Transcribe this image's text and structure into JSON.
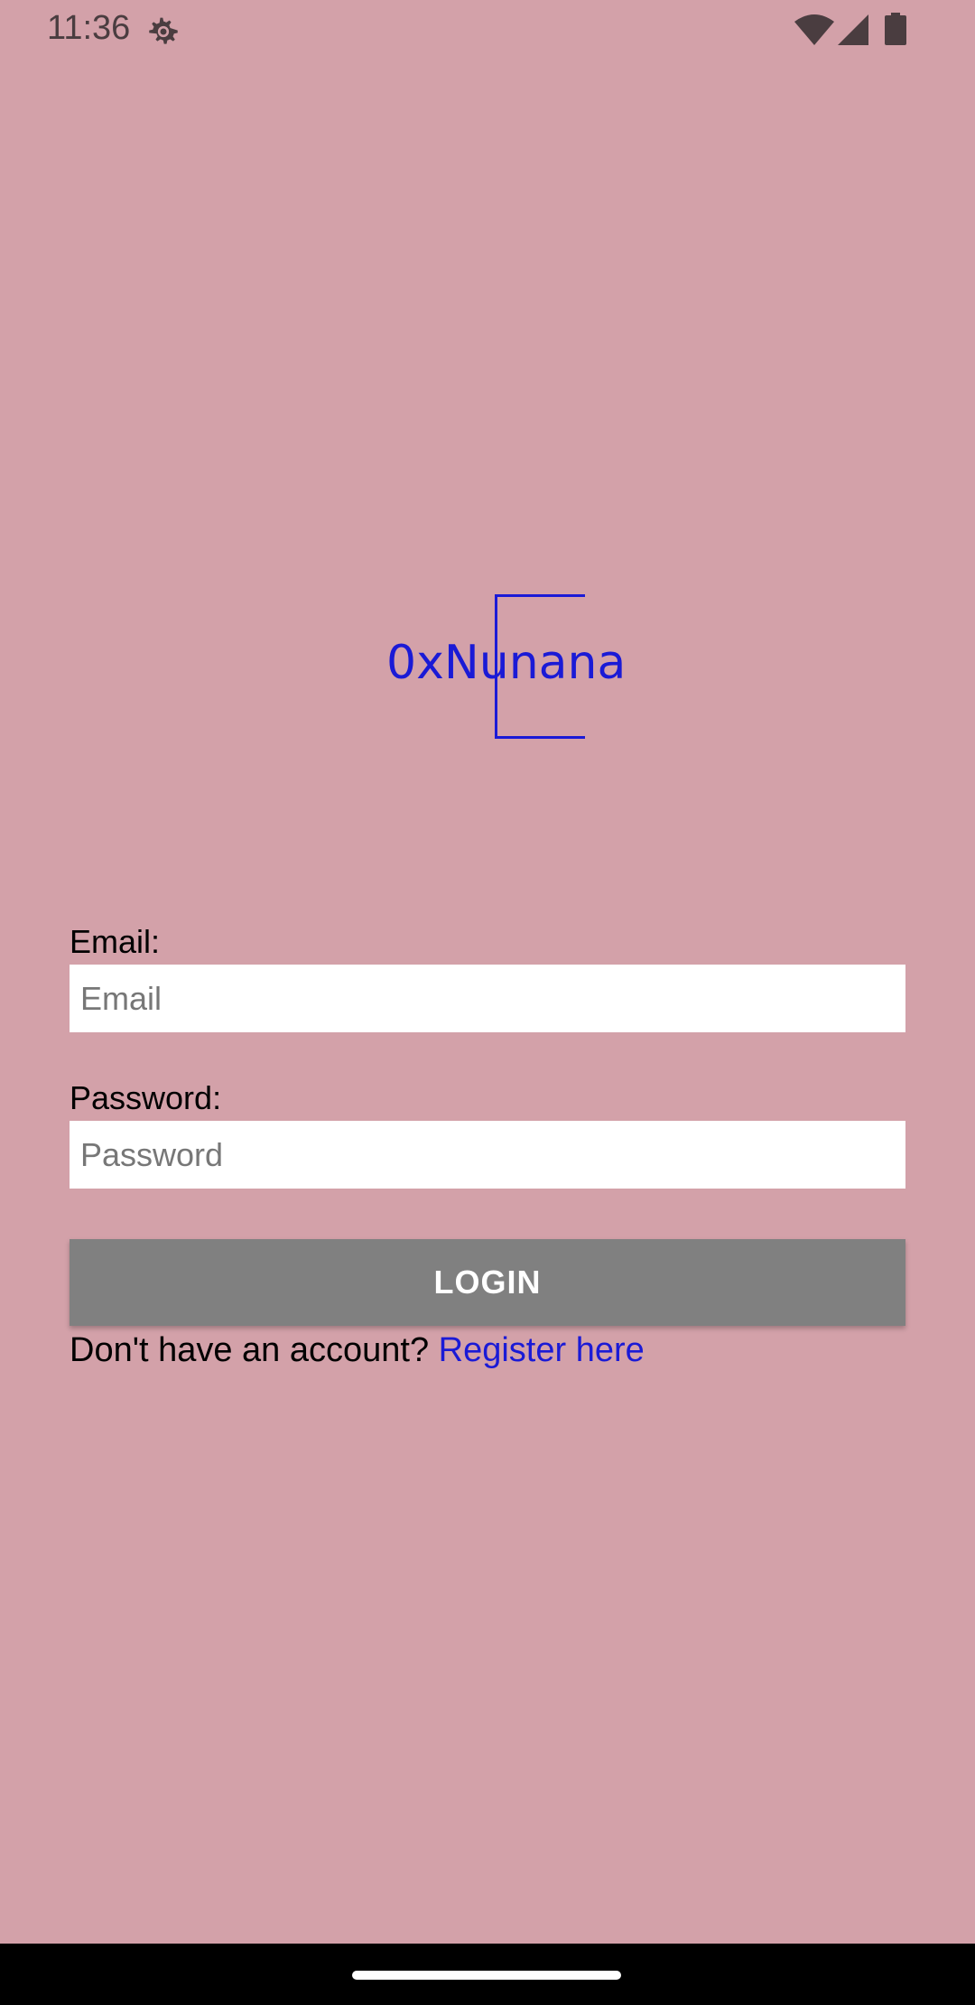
{
  "status_bar": {
    "time": "11:36",
    "icons": [
      "gear-icon",
      "wifi-icon",
      "signal-icon",
      "battery-icon"
    ]
  },
  "logo": {
    "text": "0xNunana",
    "color": "#1a1ad6"
  },
  "form": {
    "email_label": "Email:",
    "email_placeholder": "Email",
    "email_value": "",
    "password_label": "Password:",
    "password_placeholder": "Password",
    "password_value": "",
    "login_button": "LOGIN",
    "register_prompt": "Don't have an account?",
    "register_link": "Register here"
  },
  "colors": {
    "background": "#d3a1a9",
    "button": "#808080",
    "link": "#1a1ad6"
  }
}
